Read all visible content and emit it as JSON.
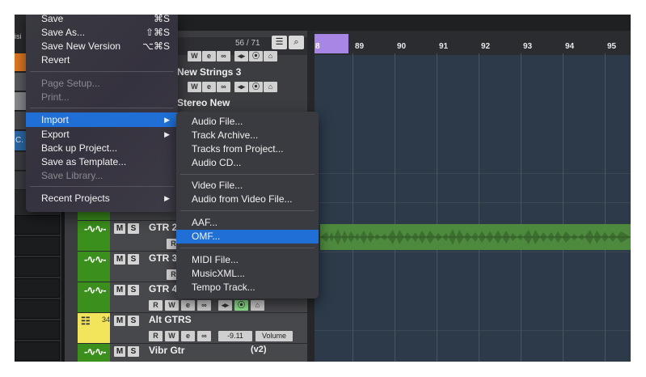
{
  "file_menu": {
    "items": [
      {
        "label": "Save",
        "shortcut": "⌘S"
      },
      {
        "label": "Save As...",
        "shortcut": "⇧⌘S"
      },
      {
        "label": "Save New Version",
        "shortcut": "⌥⌘S"
      },
      {
        "label": "Revert",
        "shortcut": ""
      },
      {
        "label": "Page Setup...",
        "shortcut": ""
      },
      {
        "label": "Print...",
        "shortcut": ""
      },
      {
        "label": "Import",
        "shortcut": ""
      },
      {
        "label": "Export",
        "shortcut": ""
      },
      {
        "label": "Back up Project...",
        "shortcut": ""
      },
      {
        "label": "Save as Template...",
        "shortcut": ""
      },
      {
        "label": "Save Library...",
        "shortcut": ""
      },
      {
        "label": "Recent Projects",
        "shortcut": ""
      }
    ],
    "submenu_arrow": "▶"
  },
  "import_submenu": {
    "items": [
      {
        "label": "Audio File..."
      },
      {
        "label": "Track Archive..."
      },
      {
        "label": "Tracks from Project..."
      },
      {
        "label": "Audio CD..."
      },
      {
        "label": "Video File..."
      },
      {
        "label": "Audio from Video File..."
      },
      {
        "label": "AAF..."
      },
      {
        "label": "OMF..."
      },
      {
        "label": "MIDI File..."
      },
      {
        "label": "MusicXML..."
      },
      {
        "label": "Tempo Track..."
      }
    ],
    "selected": "OMF..."
  },
  "track_list": {
    "count": "56 / 71",
    "left_partial_1": "isi",
    "left_partial_2": "C.",
    "upper_tracks": [
      "New Strings 3",
      "Stereo New"
    ],
    "button_labels": {
      "mute": "M",
      "solo": "S",
      "read": "R",
      "write": "W",
      "edit": "e",
      "link": "∞",
      "monitor": "◂▸",
      "record_mode": "⦿",
      "automation": "⌂"
    },
    "tracks": [
      {
        "name": "GTR 2",
        "number": "",
        "color": "#3b8f1c"
      },
      {
        "name": "GTR 3",
        "number": "",
        "color": "#3b8f1c"
      },
      {
        "name": "GTR 4",
        "number": "",
        "color": "#3b8f1c"
      },
      {
        "name": "Alt GTRS",
        "number": "34",
        "color": "#f2e55c",
        "volume_value": "-9.11",
        "volume_label": "Volume"
      },
      {
        "name": "Vibr Gtr",
        "number": "",
        "color": "#3b8f1c",
        "suffix": "(v2)"
      }
    ]
  },
  "ruler": {
    "left_partial": "8",
    "bars": [
      "89",
      "90",
      "91",
      "92",
      "93",
      "94",
      "95"
    ]
  },
  "colors": {
    "accent_selection": "#1f6fd6",
    "locator": "#a886e6",
    "audio_clip": "#4e8a3e",
    "track_green": "#3b8f1c",
    "track_yellow": "#f2e55c"
  }
}
